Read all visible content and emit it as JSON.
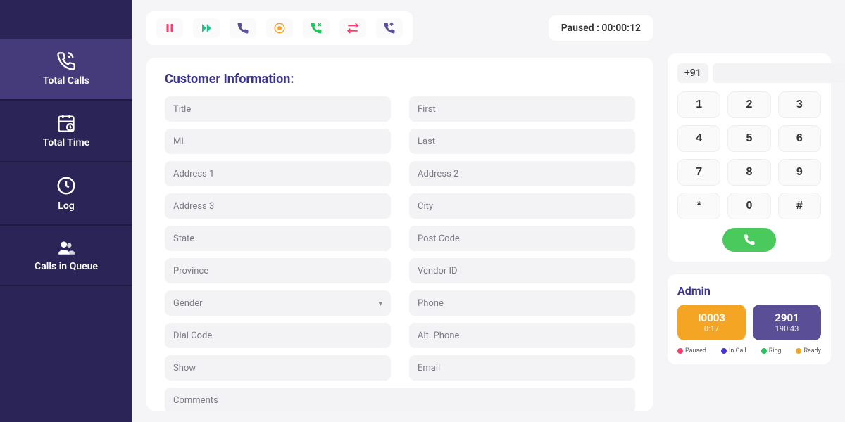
{
  "sidebar": {
    "items": [
      {
        "label": "Total Calls"
      },
      {
        "label": "Total Time"
      },
      {
        "label": "Log"
      },
      {
        "label": "Calls in Queue"
      }
    ]
  },
  "toolbar": {
    "status": "Paused : 00:00:12"
  },
  "form": {
    "title": "Customer Information:",
    "fields": {
      "title": "Title",
      "first": "First",
      "mi": "MI",
      "last": "Last",
      "address1": "Address 1",
      "address2": "Address 2",
      "address3": "Address 3",
      "city": "City",
      "state": "State",
      "postcode": "Post Code",
      "province": "Province",
      "vendor_id": "Vendor  ID",
      "gender": "Gender",
      "phone": "Phone",
      "dial_code": "Dial Code",
      "alt_phone": "Alt. Phone",
      "show": "Show",
      "email": "Email",
      "comments": "Comments"
    }
  },
  "dialpad": {
    "country_code": "+91",
    "keys": [
      "1",
      "2",
      "3",
      "4",
      "5",
      "6",
      "7",
      "8",
      "9",
      "*",
      "0",
      "#"
    ]
  },
  "admin": {
    "title": "Admin",
    "stats": [
      {
        "value": "I0003",
        "sub": "0:17",
        "color": "orange"
      },
      {
        "value": "2901",
        "sub": "190:43",
        "color": "purple"
      }
    ],
    "legend": [
      {
        "label": "Paused",
        "color": "#ff3b6b"
      },
      {
        "label": "In Call",
        "color": "#4338ca"
      },
      {
        "label": "Ring",
        "color": "#22c55e"
      },
      {
        "label": "Ready",
        "color": "#f5a524"
      }
    ]
  }
}
